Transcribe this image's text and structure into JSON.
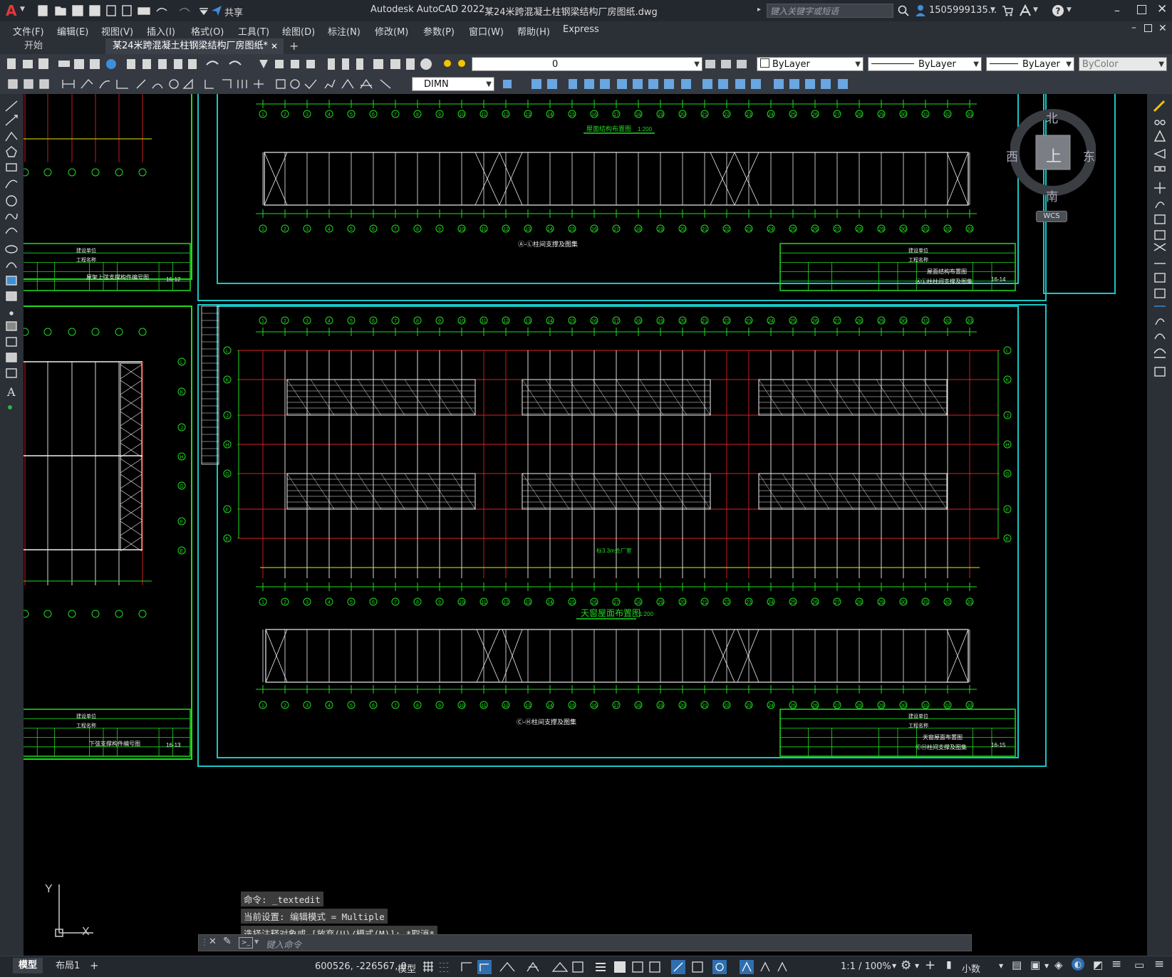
{
  "app": {
    "logo_letter": "A",
    "title": "Autodesk AutoCAD 2022",
    "document": "某24米跨混凝土柱钢梁结构厂房图纸.dwg",
    "share_label": "共享",
    "search_placeholder": "键入关键字或短语",
    "user": "1505999135...",
    "accent_color": "#3c8fd8"
  },
  "menu": [
    "文件(F)",
    "编辑(E)",
    "视图(V)",
    "插入(I)",
    "格式(O)",
    "工具(T)",
    "绘图(D)",
    "标注(N)",
    "修改(M)",
    "参数(P)",
    "窗口(W)",
    "帮助(H)",
    "Express"
  ],
  "tabs": [
    {
      "label": "开始"
    },
    {
      "label": "某24米跨混凝土柱钢梁结构厂房图纸*"
    }
  ],
  "toolbar": {
    "layer_value": "0",
    "color_value": "ByLayer",
    "linetype_value": "ByLayer",
    "lineweight_value": "ByLayer",
    "plotstyle_value": "ByColor",
    "dimstyle_value": "DIMN"
  },
  "viewcube": {
    "north": "北",
    "south": "南",
    "east": "东",
    "west": "西",
    "face": "上",
    "wcs": "WCS"
  },
  "drawing": {
    "labels": {
      "roof_layout": "屋面结构布置图",
      "roof_scale": "1:200",
      "col_brace_al": "Ⓐ-Ⓛ柱间支撑及图集",
      "skylight_roof": "天窗屋面布置图",
      "skylight_scale": "1:200",
      "col_brace_ch": "Ⓒ-Ⓗ柱间支撑及图集",
      "elev_note": "标3.3m处厂室",
      "upper_brace_left": "屋架上弦支撑构件编号图",
      "lower_brace_left": "下弦支撑构件编号图"
    },
    "title_blocks": {
      "tb_right_top": {
        "sheet_no": "16-14",
        "name1": "屋面结构布置图",
        "name2": "ⒶⓁ柱柱间支撑及图集"
      },
      "tb_right_bottom": {
        "sheet_no": "16-15",
        "name1": "天窗屋面布置图",
        "name2": "ⒸⒽ柱间支撑及图集"
      },
      "tb_left_top": {
        "sheet_no": "16-12"
      },
      "tb_left_bottom": {
        "sheet_no": "16-13"
      },
      "owner_label": "建设单位",
      "project_label": "工程名称"
    },
    "grid_numbers": [
      "1",
      "2",
      "3",
      "4",
      "5",
      "6",
      "7",
      "8",
      "9",
      "10",
      "11",
      "12",
      "13",
      "14",
      "15",
      "16",
      "17",
      "18",
      "19",
      "20",
      "21",
      "22",
      "23",
      "24",
      "25",
      "26",
      "27",
      "28",
      "29",
      "30",
      "31",
      "32",
      "33"
    ],
    "row_letters": [
      "L",
      "K",
      "J",
      "H",
      "G",
      "F",
      "E"
    ]
  },
  "ucs": {
    "x": "X",
    "y": "Y"
  },
  "command": {
    "history": [
      "命令: _textedit",
      "当前设置: 编辑模式 = Multiple",
      "选择注释对象或 [放弃(U)/模式(M)]: *取消*"
    ],
    "placeholder": "键入命令"
  },
  "layout_tabs": [
    {
      "label": "模型"
    },
    {
      "label": "布局1"
    }
  ],
  "status": {
    "coords": "600526, -226567, 0",
    "mode": "模型",
    "scale": "1:1 / 100%",
    "units": "小数"
  }
}
